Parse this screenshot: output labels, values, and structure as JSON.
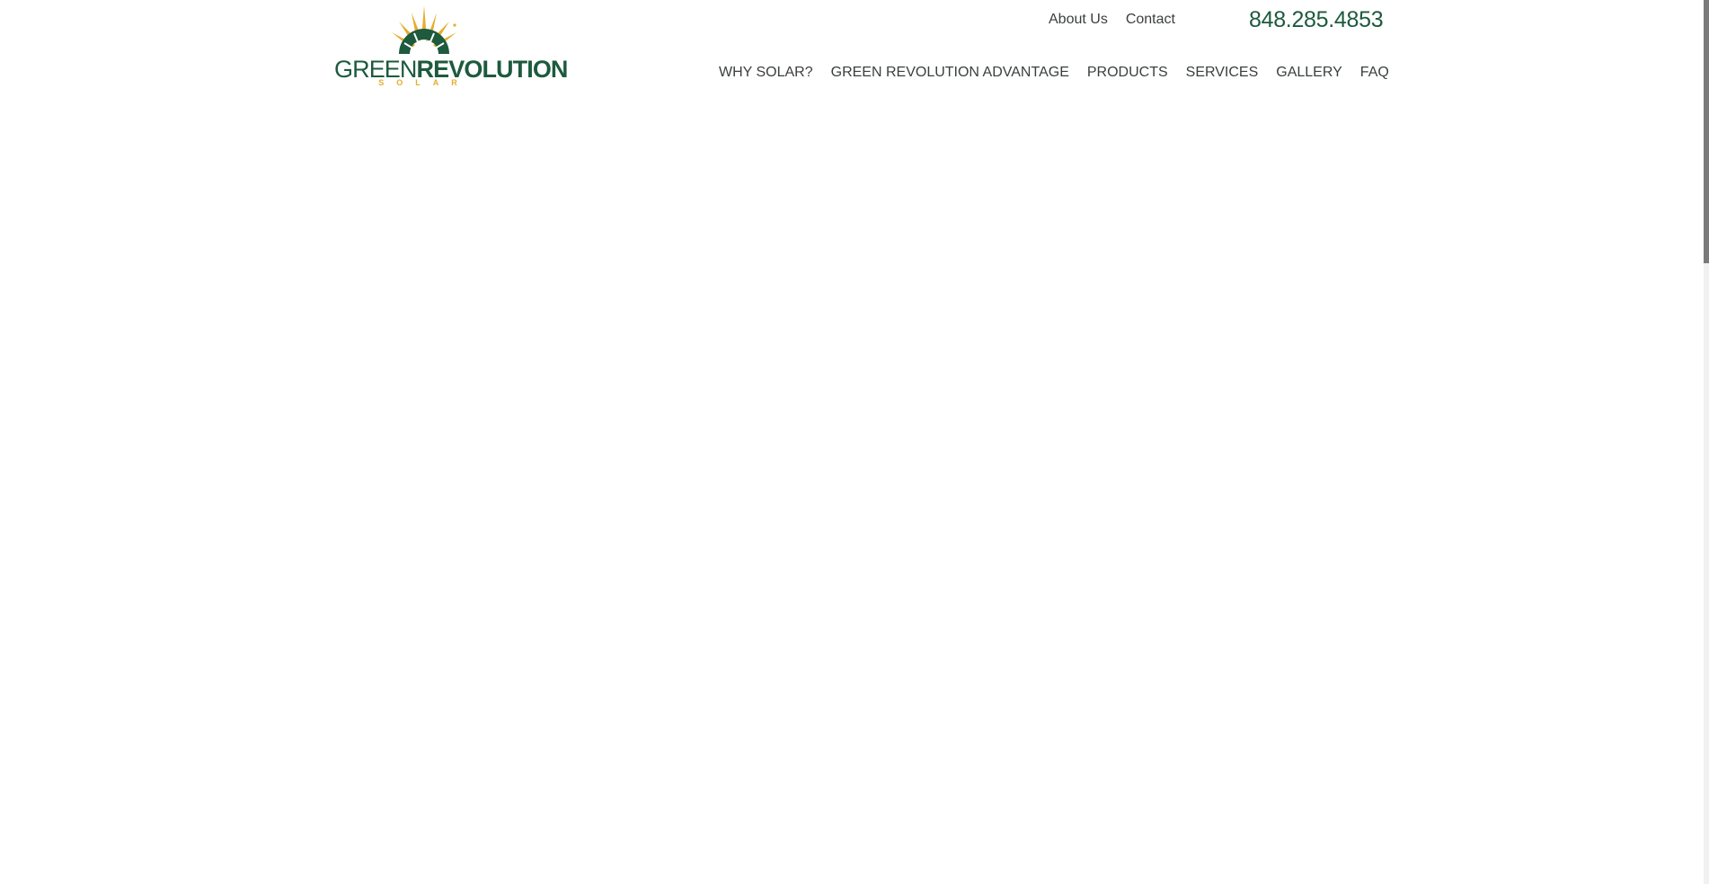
{
  "header": {
    "logo": {
      "name_light": "GREEN",
      "name_bold": "REVOLUTION",
      "tagline": "SOLAR",
      "colors": {
        "green": "#1d5a3e",
        "gold": "#e6ad2b"
      }
    },
    "utility_links": [
      "About Us",
      "Contact"
    ],
    "phone": "848.285.4853"
  },
  "main_nav": {
    "items": [
      "WHY SOLAR?",
      "GREEN REVOLUTION ADVANTAGE",
      "PRODUCTS",
      "SERVICES",
      "GALLERY",
      "FAQ"
    ]
  }
}
